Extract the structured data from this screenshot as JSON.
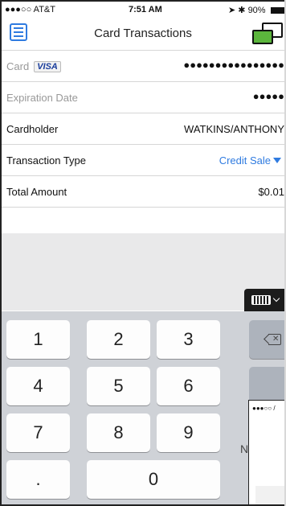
{
  "status_bar": {
    "carrier": "●●●○○ AT&T",
    "time": "7:51 AM",
    "battery": "90%"
  },
  "nav": {
    "title": "Card Transactions",
    "left_icon": "list-icon",
    "right_icon": "switch-device-icon"
  },
  "form": {
    "card": {
      "label": "Card",
      "brand": "VISA",
      "value": "●●●●●●●●●●●●●●●●"
    },
    "expiration": {
      "label": "Expiration Date",
      "value": "●●●●●"
    },
    "cardholder": {
      "label": "Cardholder",
      "value": "WATKINS/ANTHONY"
    },
    "transaction_type": {
      "label": "Transaction Type",
      "value": "Credit Sale"
    },
    "total_amount": {
      "label": "Total Amount",
      "value": "$0.01"
    }
  },
  "keyboard": {
    "keys": [
      "1",
      "2",
      "3",
      "4",
      "5",
      "6",
      "7",
      "8",
      "9",
      ".",
      "0"
    ],
    "partial_key_label": "N",
    "delete_icon": "backspace-icon",
    "dismiss_icon": "keyboard-dismiss-icon"
  },
  "overlay": {
    "status": "●●●○○ /"
  },
  "colors": {
    "accent": "#2f7be0",
    "switch_green": "#5bb53c",
    "keyboard_bg": "#cfd2d7"
  }
}
